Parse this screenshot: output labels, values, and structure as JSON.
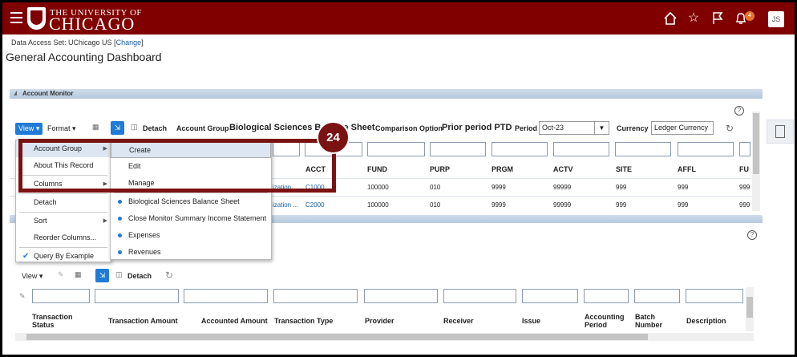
{
  "header": {
    "logo_top": "THE UNIVERSITY OF",
    "logo_bottom": "CHICAGO",
    "notification_count": "4",
    "avatar_initials": "JS"
  },
  "data_access": {
    "label": "Data Access Set: UChicago US",
    "open_bracket": "[",
    "link": "Change",
    "close_bracket": "]"
  },
  "page_title": "General Accounting Dashboard",
  "account_monitor": {
    "panel_title": "Account Monitor",
    "toolbar": {
      "view": "View ▾",
      "format": "Format ▾",
      "detach": "Detach",
      "account_group_label": "Account Group",
      "account_group_value": "Biological Sciences Balance Sheet",
      "comparison_label": "Comparison Option",
      "comparison_value": "Prior period PTD",
      "period_label": "Period",
      "period_value": "Oct-23",
      "currency_label": "Currency",
      "currency_value": "Ledger Currency"
    },
    "columns": [
      "ACCT",
      "FUND",
      "PURP",
      "PRGM",
      "ACTV",
      "SITE",
      "AFFL",
      "FU"
    ],
    "rows": [
      {
        "org": "ization ...",
        "ACCT": "C1000",
        "FUND": "100000",
        "PURP": "010",
        "PRGM": "9999",
        "ACTV": "99999",
        "SITE": "999",
        "AFFL": "999",
        "FU": "999"
      },
      {
        "org": "ization ...",
        "ACCT": "C2000",
        "FUND": "100000",
        "PURP": "010",
        "PRGM": "9999",
        "ACTV": "99999",
        "SITE": "999",
        "AFFL": "999",
        "FU": "999"
      }
    ]
  },
  "view_menu": {
    "items": [
      "Account Group",
      "About This Record",
      "Columns",
      "Detach",
      "Sort",
      "Reorder Columns...",
      "Query By Example"
    ]
  },
  "account_group_submenu": {
    "items": [
      "Create",
      "Edit",
      "Manage"
    ],
    "groups": [
      "Biological Sciences Balance Sheet",
      "Close Monitor Summary Income Statement",
      "Expenses",
      "Revenues"
    ]
  },
  "callout_number": "24",
  "transactions": {
    "toolbar": {
      "view": "View ▾",
      "detach": "Detach"
    },
    "columns": [
      "Transaction Status",
      "Transaction Amount",
      "Accounted Amount",
      "Transaction Type",
      "Provider",
      "Receiver",
      "Issue",
      "Accounting Period",
      "Batch Number",
      "Description"
    ]
  },
  "colors": {
    "brand": "#800000",
    "accent": "#1f7bd8",
    "callout": "#7a1212"
  }
}
